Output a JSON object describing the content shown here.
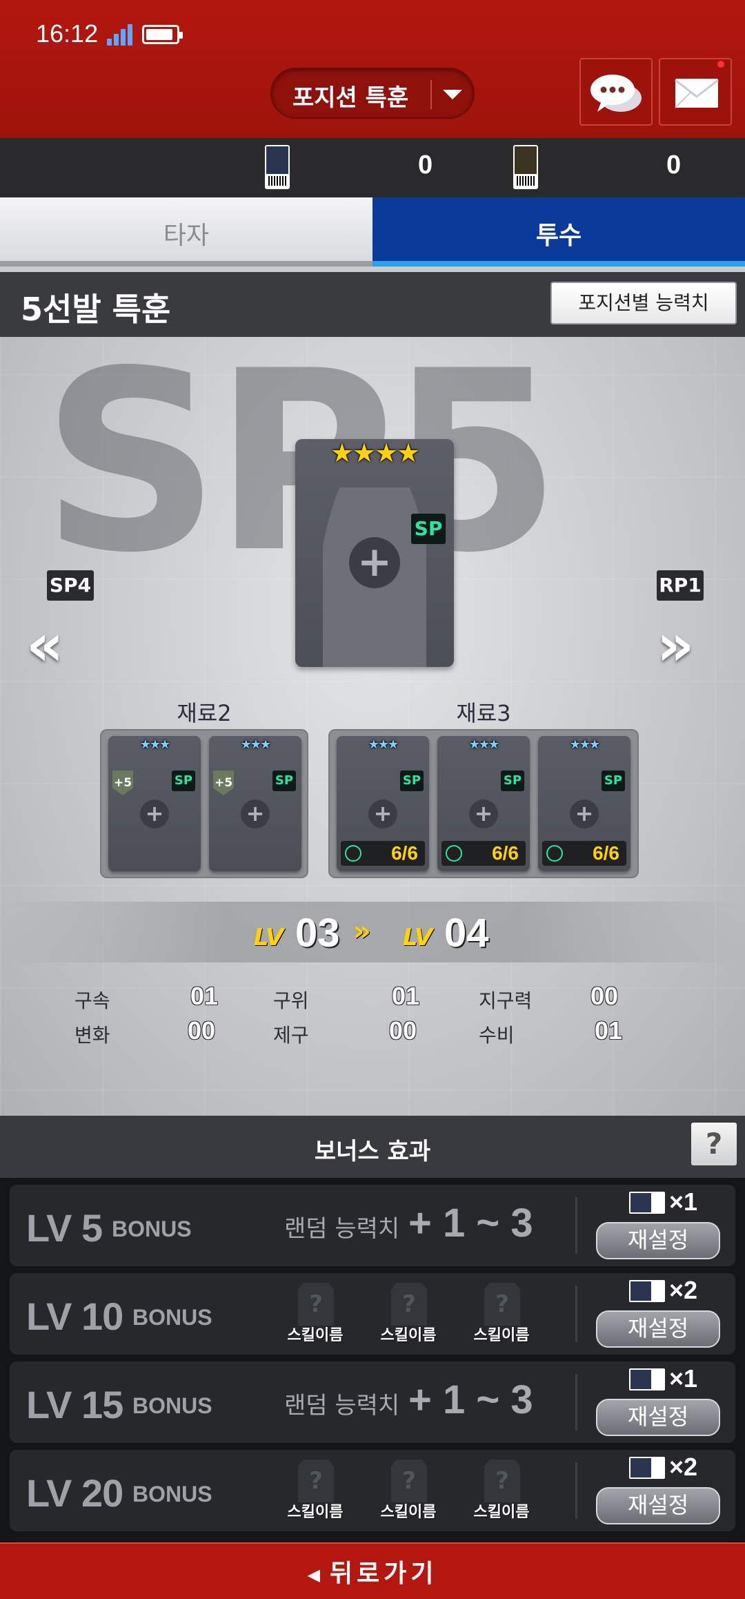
{
  "status_bar": {
    "time": "16:12"
  },
  "header": {
    "position_select": "포지션 특훈",
    "chat_icon": "chat-bubbles-icon",
    "mail_icon": "envelope-icon"
  },
  "resources": [
    {
      "icon": "player-reset-ticket-icon",
      "count": "0"
    },
    {
      "icon": "ability-reset-ticket-icon",
      "count": "0"
    }
  ],
  "tabs": [
    {
      "label": "타자",
      "active": false
    },
    {
      "label": "투수",
      "active": true
    }
  ],
  "training": {
    "title": "5선발 특훈",
    "ability_button": "포지션별 능력치",
    "bg_text": "SP5",
    "prev_position": "SP4",
    "next_position": "RP1",
    "main_card": {
      "stars": "★★★★",
      "badge": "SP"
    },
    "material2": {
      "label": "재료2",
      "cards": [
        {
          "stars": "★★★",
          "badge": "SP",
          "enhance": "+5"
        },
        {
          "stars": "★★★",
          "badge": "SP",
          "enhance": "+5"
        }
      ]
    },
    "material3": {
      "label": "재료3",
      "cards": [
        {
          "stars": "★★★",
          "badge": "SP",
          "count": "6/6"
        },
        {
          "stars": "★★★",
          "badge": "SP",
          "count": "6/6"
        },
        {
          "stars": "★★★",
          "badge": "SP",
          "count": "6/6"
        }
      ]
    },
    "level": {
      "tag": "LV",
      "from": "03",
      "arrow": "»",
      "to": "04"
    },
    "stats": [
      {
        "name": "구속",
        "value": "01"
      },
      {
        "name": "구위",
        "value": "01"
      },
      {
        "name": "지구력",
        "value": "00"
      },
      {
        "name": "변화",
        "value": "00"
      },
      {
        "name": "제구",
        "value": "00"
      },
      {
        "name": "수비",
        "value": "01"
      }
    ]
  },
  "bonus": {
    "title": "보너스 효과",
    "help": "?",
    "rows": [
      {
        "lv": "LV 5",
        "word": "BONUS",
        "desc": "랜덤 능력치",
        "range": "+ 1 ~ 3",
        "cost": "×1",
        "button": "재설정"
      },
      {
        "lv": "LV 10",
        "word": "BONUS",
        "skills": [
          "스킬이름",
          "스킬이름",
          "스킬이름"
        ],
        "cost": "×2",
        "button": "재설정"
      },
      {
        "lv": "LV 15",
        "word": "BONUS",
        "desc": "랜덤 능력치",
        "range": "+ 1 ~ 3",
        "cost": "×1",
        "button": "재설정"
      },
      {
        "lv": "LV 20",
        "word": "BONUS",
        "skills": [
          "스킬이름",
          "스킬이름",
          "스킬이름"
        ],
        "cost": "×2",
        "button": "재설정"
      }
    ]
  },
  "footer": {
    "back": "뒤로가기"
  },
  "colors": {
    "header_red": "#b3170f",
    "active_tab_blue": "#0a3a9a",
    "sp_green": "#2be5a4",
    "level_yellow": "#ffd400"
  }
}
